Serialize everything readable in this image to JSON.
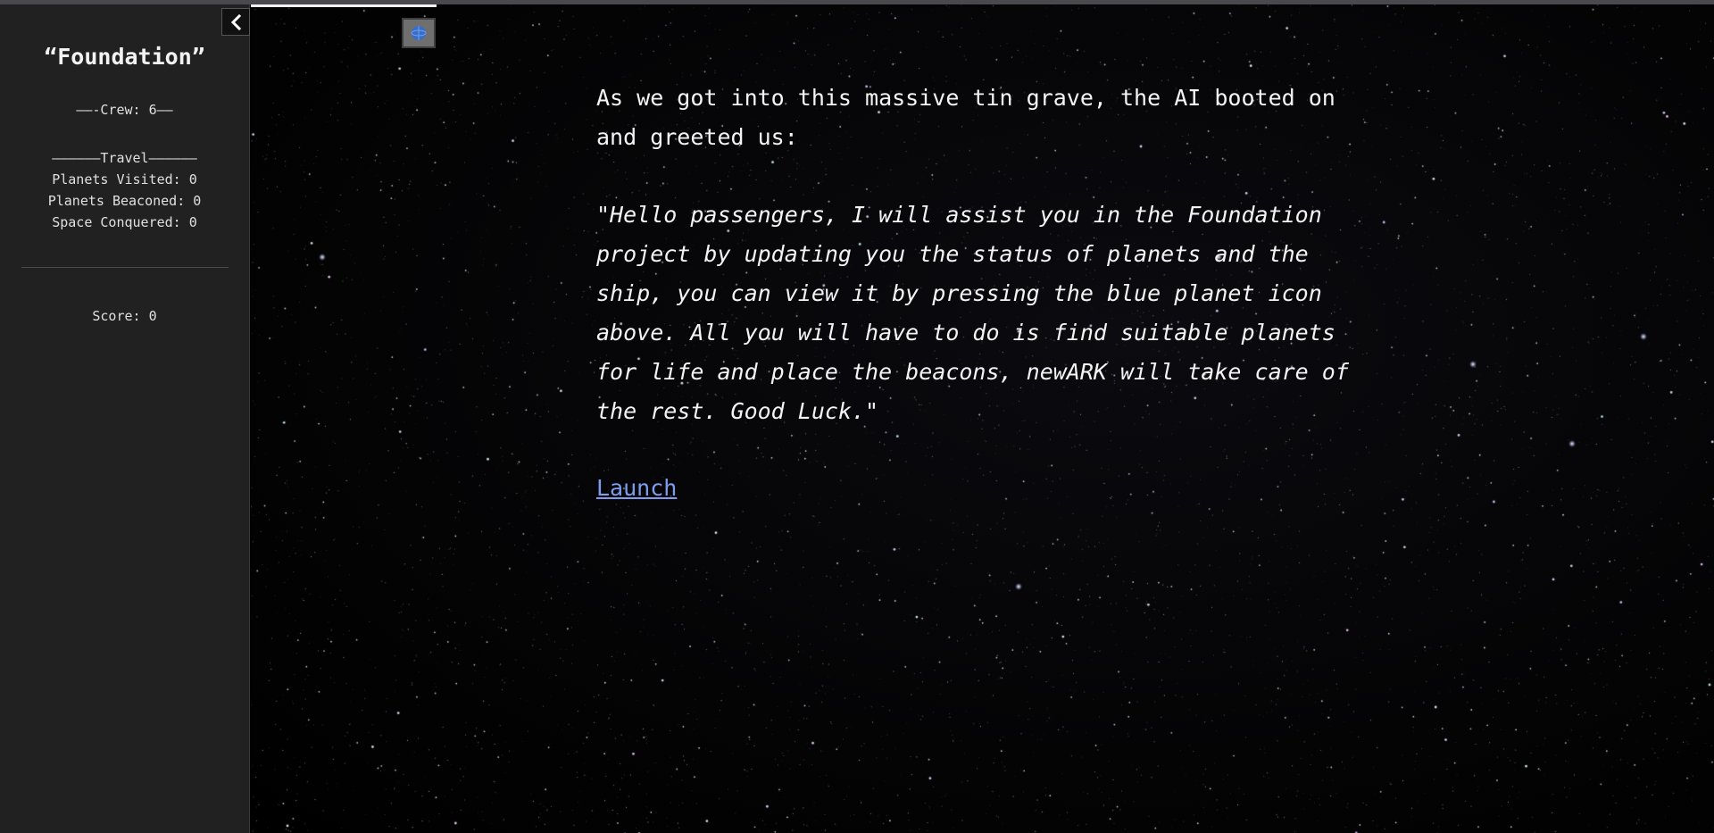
{
  "sidebar": {
    "title": "“Foundation”",
    "crew": "——-Crew: 6——",
    "travel_header": "——————Travel——————",
    "planets_visited": "Planets Visited: 0",
    "planets_beaconed": "Planets Beaconed: 0",
    "space_conquered": "Space Conquered: 0",
    "score": "Score: 0",
    "toggle_icon": "chevron-left-icon"
  },
  "toolbar": {
    "planet_icon": "blue-planet-icon"
  },
  "passage": {
    "intro": "As we got into this massive tin grave, the AI booted on and greeted us:",
    "quote": "\"Hello passengers, I will assist you in the Foundation project by updating you the status of planets and the ship, you can view it by pressing the blue planet icon above. All you will have to do is find suitable planets for life and place the beacons, newARK will take care of the rest. Good Luck.\"",
    "link": "Launch"
  },
  "colors": {
    "sidebar_bg": "#212121",
    "link": "#7f9dee",
    "planet_icon": "#2f6fd6"
  }
}
